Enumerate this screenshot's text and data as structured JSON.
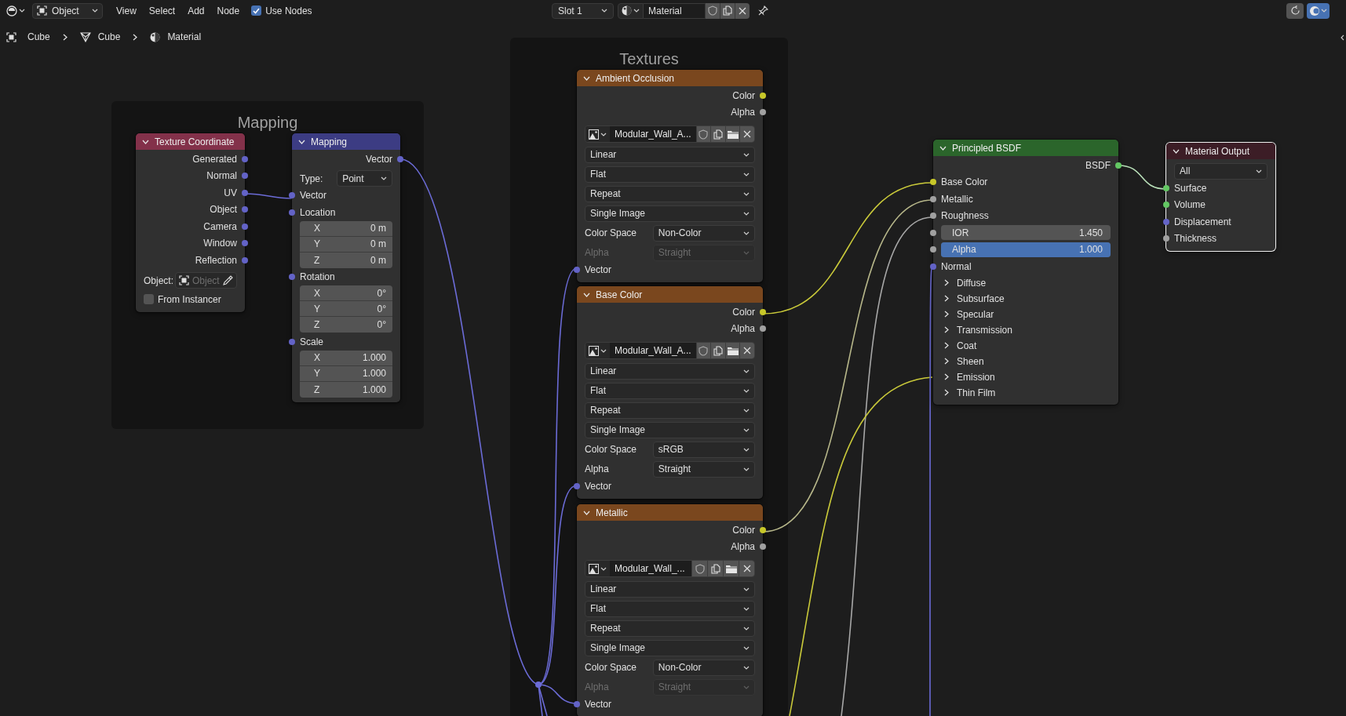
{
  "header": {
    "mode": "Object",
    "menus": [
      "View",
      "Select",
      "Add",
      "Node"
    ],
    "use_nodes": {
      "label": "Use Nodes",
      "checked": true
    },
    "slot": "Slot 1",
    "material": "Material"
  },
  "breadcrumbs": [
    {
      "label": "Cube",
      "kind": "object"
    },
    {
      "label": "Cube",
      "kind": "mesh"
    },
    {
      "label": "Material",
      "kind": "material"
    }
  ],
  "frames": [
    {
      "label": "Mapping"
    },
    {
      "label": "Textures"
    }
  ],
  "nodes": [
    {
      "title": "Texture Coordinate",
      "color": "#83314a",
      "selected": false,
      "rows": [
        {
          "kind": "output",
          "label": "Generated",
          "color": "#6363c7"
        },
        {
          "kind": "output",
          "label": "Normal",
          "color": "#6363c7"
        },
        {
          "kind": "output",
          "label": "UV",
          "color": "#6363c7"
        },
        {
          "kind": "output",
          "label": "Object",
          "color": "#6363c7"
        },
        {
          "kind": "output",
          "label": "Camera",
          "color": "#6363c7"
        },
        {
          "kind": "output",
          "label": "Window",
          "color": "#6363c7"
        },
        {
          "kind": "output",
          "label": "Reflection",
          "color": "#6363c7"
        },
        {
          "kind": "object_field",
          "label": "Object:",
          "placeholder": "Object"
        },
        {
          "kind": "checkbox",
          "label": "From Instancer",
          "checked": false
        }
      ]
    },
    {
      "title": "Mapping",
      "color": "#3c3c83",
      "selected": false,
      "rows": [
        {
          "kind": "output",
          "label": "Vector",
          "color": "#6363c7"
        },
        {
          "kind": "dropdown",
          "label": "Type:",
          "value": "Point",
          "disabled": false
        },
        {
          "kind": "input",
          "label": "Vector",
          "color": "#6363c7"
        },
        {
          "kind": "input",
          "label": "Location",
          "color": "#6363c7"
        },
        {
          "kind": "vector",
          "axes": [
            {
              "axis": "X",
              "value": "0 m"
            },
            {
              "axis": "Y",
              "value": "0 m"
            },
            {
              "axis": "Z",
              "value": "0 m"
            }
          ]
        },
        {
          "kind": "input",
          "label": "Rotation",
          "color": "#6363c7"
        },
        {
          "kind": "vector",
          "axes": [
            {
              "axis": "X",
              "value": "0°"
            },
            {
              "axis": "Y",
              "value": "0°"
            },
            {
              "axis": "Z",
              "value": "0°"
            }
          ]
        },
        {
          "kind": "input",
          "label": "Scale",
          "color": "#6363c7"
        },
        {
          "kind": "vector",
          "axes": [
            {
              "axis": "X",
              "value": "1.000"
            },
            {
              "axis": "Y",
              "value": "1.000"
            },
            {
              "axis": "Z",
              "value": "1.000"
            }
          ]
        }
      ]
    },
    {
      "title": "Ambient Occlusion",
      "color": "#7a471e",
      "selected": false,
      "rows": [
        {
          "kind": "output",
          "label": "Color",
          "color": "#c7c729"
        },
        {
          "kind": "output",
          "label": "Alpha",
          "color": "#a1a1a1"
        },
        {
          "kind": "image",
          "name": "Modular_Wall_A..."
        },
        {
          "kind": "dropdown",
          "value": "Linear"
        },
        {
          "kind": "dropdown",
          "value": "Flat"
        },
        {
          "kind": "dropdown",
          "value": "Repeat"
        },
        {
          "kind": "dropdown",
          "value": "Single Image"
        },
        {
          "kind": "dropdown",
          "label": "Color Space",
          "value": "Non-Color",
          "disabled": false
        },
        {
          "kind": "dropdown",
          "label": "Alpha",
          "value": "Straight",
          "disabled": true
        },
        {
          "kind": "input",
          "label": "Vector",
          "color": "#6363c7"
        }
      ]
    },
    {
      "title": "Base Color",
      "color": "#7a471e",
      "selected": false,
      "rows": [
        {
          "kind": "output",
          "label": "Color",
          "color": "#c7c729"
        },
        {
          "kind": "output",
          "label": "Alpha",
          "color": "#a1a1a1"
        },
        {
          "kind": "image",
          "name": "Modular_Wall_A..."
        },
        {
          "kind": "dropdown",
          "value": "Linear"
        },
        {
          "kind": "dropdown",
          "value": "Flat"
        },
        {
          "kind": "dropdown",
          "value": "Repeat"
        },
        {
          "kind": "dropdown",
          "value": "Single Image"
        },
        {
          "kind": "dropdown",
          "label": "Color Space",
          "value": "sRGB",
          "disabled": false
        },
        {
          "kind": "dropdown",
          "label": "Alpha",
          "value": "Straight",
          "disabled": false
        },
        {
          "kind": "input",
          "label": "Vector",
          "color": "#6363c7"
        }
      ]
    },
    {
      "title": "Metallic",
      "color": "#7a471e",
      "selected": false,
      "rows": [
        {
          "kind": "output",
          "label": "Color",
          "color": "#c7c729"
        },
        {
          "kind": "output",
          "label": "Alpha",
          "color": "#a1a1a1"
        },
        {
          "kind": "image",
          "name": "Modular_Wall_..."
        },
        {
          "kind": "dropdown",
          "value": "Linear"
        },
        {
          "kind": "dropdown",
          "value": "Flat"
        },
        {
          "kind": "dropdown",
          "value": "Repeat"
        },
        {
          "kind": "dropdown",
          "value": "Single Image"
        },
        {
          "kind": "dropdown",
          "label": "Color Space",
          "value": "Non-Color",
          "disabled": false
        },
        {
          "kind": "dropdown",
          "label": "Alpha",
          "value": "Straight",
          "disabled": true
        },
        {
          "kind": "input",
          "label": "Vector",
          "color": "#6363c7"
        }
      ]
    },
    {
      "title": "Principled BSDF",
      "color": "#2b652b",
      "selected": false,
      "rows": [
        {
          "kind": "output",
          "label": "BSDF",
          "color": "#63c763"
        },
        {
          "kind": "input",
          "label": "Base Color",
          "color": "#c7c729"
        },
        {
          "kind": "input",
          "label": "Metallic",
          "color": "#a1a1a1"
        },
        {
          "kind": "input",
          "label": "Roughness",
          "color": "#a1a1a1"
        },
        {
          "kind": "value",
          "label": "IOR",
          "value": "1.450",
          "color": "#a1a1a1"
        },
        {
          "kind": "value",
          "label": "Alpha",
          "value": "1.000",
          "color": "#a1a1a1",
          "level": 1
        },
        {
          "kind": "input",
          "label": "Normal",
          "color": "#6363c7"
        },
        {
          "kind": "panel",
          "label": "Diffuse",
          "expanded": false
        },
        {
          "kind": "panel",
          "label": "Subsurface",
          "expanded": false
        },
        {
          "kind": "panel",
          "label": "Specular",
          "expanded": false
        },
        {
          "kind": "panel",
          "label": "Transmission",
          "expanded": false
        },
        {
          "kind": "panel",
          "label": "Coat",
          "expanded": false
        },
        {
          "kind": "panel",
          "label": "Sheen",
          "expanded": false
        },
        {
          "kind": "panel",
          "label": "Emission",
          "expanded": false
        },
        {
          "kind": "panel",
          "label": "Thin Film",
          "expanded": false
        }
      ]
    },
    {
      "title": "Material Output",
      "color": "#3c1d26",
      "selected": true,
      "rows": [
        {
          "kind": "dropdown",
          "value": "All"
        },
        {
          "kind": "input",
          "label": "Surface",
          "color": "#63c763"
        },
        {
          "kind": "input",
          "label": "Volume",
          "color": "#63c763"
        },
        {
          "kind": "input",
          "label": "Displacement",
          "color": "#6363c7"
        },
        {
          "kind": "input",
          "label": "Thickness",
          "color": "#a1a1a1"
        }
      ]
    }
  ]
}
